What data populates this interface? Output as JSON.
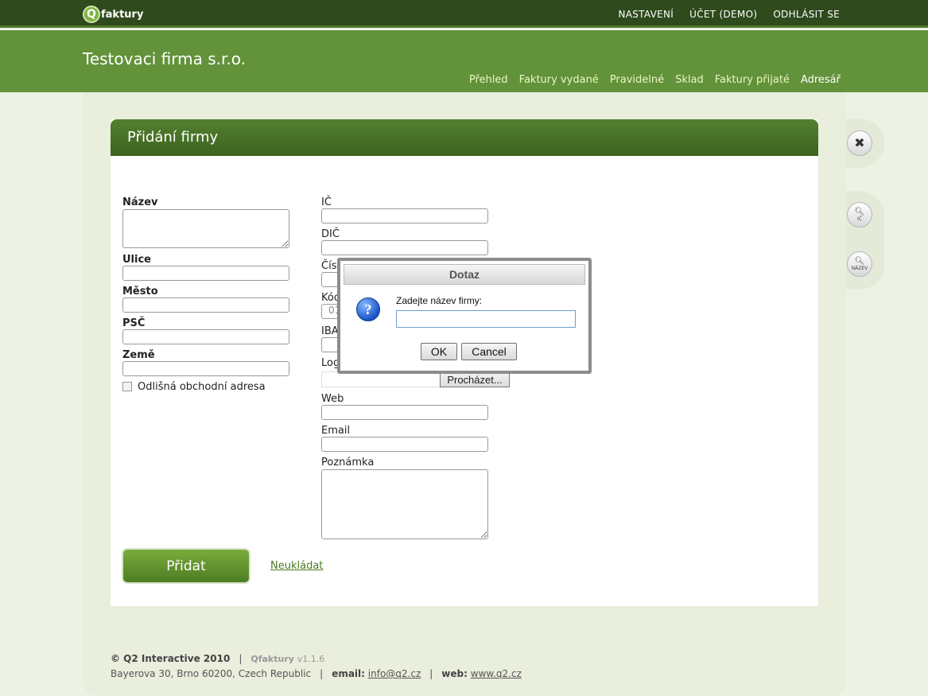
{
  "topbar": {
    "logo_letter": "Q",
    "logo_text": "faktury",
    "nav": [
      "NASTAVENÍ",
      "ÚČET (DEMO)",
      "ODHLÁSIT SE"
    ]
  },
  "header": {
    "company": "Testovaci firma s.r.o.",
    "nav": [
      "Přehled",
      "Faktury vydané",
      "Pravidelné",
      "Sklad",
      "Faktury přijaté",
      "Adresář"
    ],
    "active": "Adresář"
  },
  "panel": {
    "title": "Přidání firmy"
  },
  "form": {
    "left": {
      "nazev": "Název",
      "ulice": "Ulice",
      "mesto": "Město",
      "psc": "PSČ",
      "zeme": "Země",
      "checkbox_label": "Odlišná obchodní adresa"
    },
    "right": {
      "ic": "IČ",
      "dic": "DIČ",
      "cislo_partial": "Čís",
      "kod_partial": "Kód",
      "kod_value_partial": "01",
      "iban_partial": "IBA",
      "logo_partial": "Log",
      "browse": "Procházet...",
      "web": "Web",
      "email": "Email",
      "poznamka": "Poznámka"
    },
    "submit": "Přidat",
    "cancel_link": "Neukládat"
  },
  "side_tools": {
    "close_icon": "close-icon",
    "ic_caption": "IČ",
    "nazev_caption": "NÁZEV"
  },
  "footer": {
    "copyright": "© Q2 Interactive 2010",
    "sep": "|",
    "product": "Qfaktury",
    "version": "v1.1.6",
    "address": "Bayerova 30, Brno 60200, Czech Republic",
    "email_label": "email:",
    "email": "info@q2.cz",
    "web_label": "web:",
    "web": "www.q2.cz"
  },
  "dialog": {
    "title": "Dotaz",
    "message": "Zadejte název firmy:",
    "input_value": "",
    "ok": "OK",
    "cancel": "Cancel"
  }
}
